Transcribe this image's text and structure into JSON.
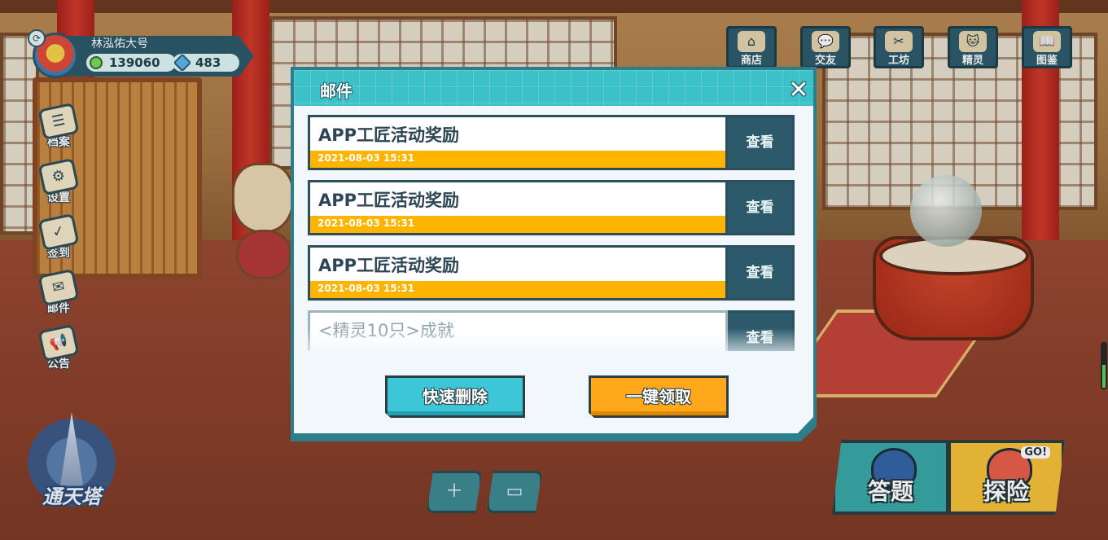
{
  "player": {
    "name": "林泓佑大号",
    "coins": "139060",
    "gems": "483"
  },
  "sidebar": {
    "items": [
      {
        "label": "档案",
        "icon": "archive-icon"
      },
      {
        "label": "设置",
        "icon": "settings-icon"
      },
      {
        "label": "签到",
        "icon": "checkin-calendar-icon"
      },
      {
        "label": "邮件",
        "icon": "mail-icon"
      },
      {
        "label": "公告",
        "icon": "megaphone-icon"
      }
    ]
  },
  "topbar": {
    "items": [
      {
        "label": "商店",
        "icon": "shop-icon"
      },
      {
        "label": "交友",
        "icon": "chat-bubble-icon"
      },
      {
        "label": "工坊",
        "icon": "tools-icon"
      },
      {
        "label": "精灵",
        "icon": "spirit-cat-icon"
      },
      {
        "label": "图鉴",
        "icon": "book-icon"
      }
    ]
  },
  "tower": {
    "label": "通天塔"
  },
  "bottom_right": {
    "answer_label": "答题",
    "explore_label": "探险",
    "go_tag": "GO!"
  },
  "mail_dialog": {
    "title": "邮件",
    "close_icon": "close-icon",
    "view_label": "查看",
    "mails": [
      {
        "title": "APP工匠活动奖励",
        "date": "2021-08-03 15:31"
      },
      {
        "title": "APP工匠活动奖励",
        "date": "2021-08-03 15:31"
      },
      {
        "title": "APP工匠活动奖励",
        "date": "2021-08-03 15:31"
      },
      {
        "title": "<精灵10只>成就",
        "date": ""
      }
    ],
    "delete_label": "快速删除",
    "collect_label": "一键领取"
  },
  "colors": {
    "header_teal": "#3cc1c8",
    "card_border": "#2d4f5c",
    "date_bar_orange": "#ffb400",
    "view_button": "#2d5a6b",
    "delete_button": "#3cc6d6",
    "collect_button": "#ffa81b"
  }
}
